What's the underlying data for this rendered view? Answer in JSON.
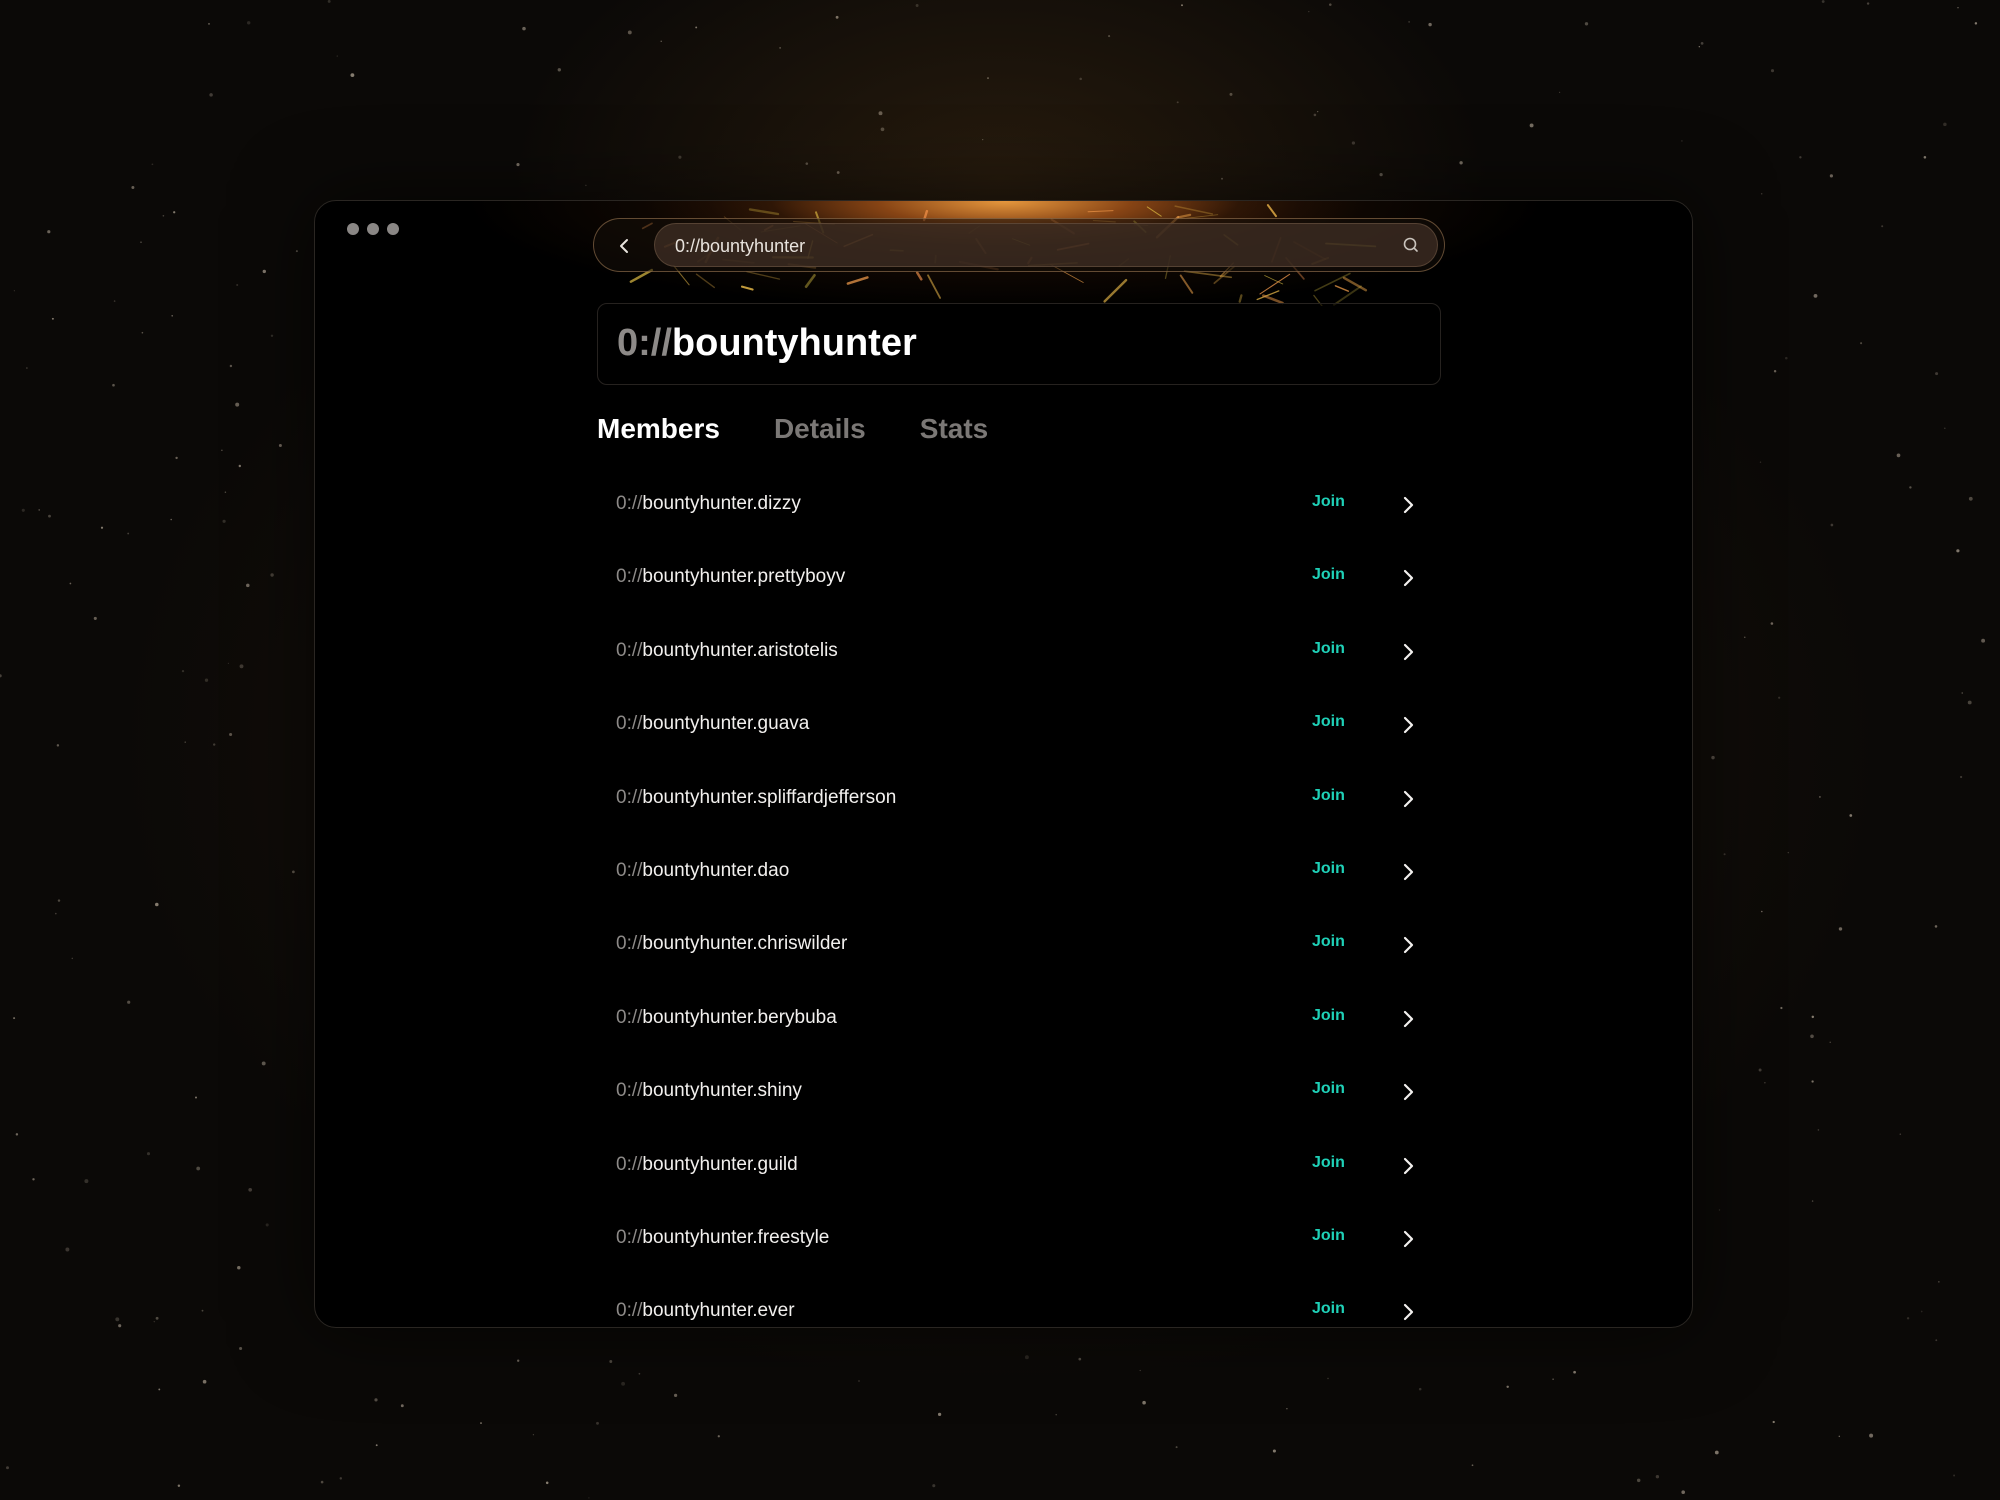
{
  "window": {
    "controls": [
      "window-dot",
      "window-dot",
      "window-dot"
    ]
  },
  "urlbar": {
    "back_icon": "chevron-left-icon",
    "value": "0://bountyhunter",
    "search_icon": "search-icon"
  },
  "header": {
    "title_prefix": "0://",
    "title_name": "bountyhunter"
  },
  "tabs": [
    {
      "label": "Members",
      "active": true
    },
    {
      "label": "Details",
      "active": false
    },
    {
      "label": "Stats",
      "active": false
    }
  ],
  "colors": {
    "accent": "#1fd1b8",
    "text": "#f2f0ee",
    "muted": "#8d8a88",
    "background": "#000000"
  },
  "members": {
    "prefix": "0://",
    "join_label": "Join",
    "row_icon": "chevron-right-icon",
    "items": [
      {
        "name": "bountyhunter.dizzy"
      },
      {
        "name": "bountyhunter.prettyboyv"
      },
      {
        "name": "bountyhunter.aristotelis"
      },
      {
        "name": "bountyhunter.guava"
      },
      {
        "name": "bountyhunter.spliffardjefferson"
      },
      {
        "name": "bountyhunter.dao"
      },
      {
        "name": "bountyhunter.chriswilder"
      },
      {
        "name": "bountyhunter.berybuba"
      },
      {
        "name": "bountyhunter.shiny"
      },
      {
        "name": "bountyhunter.guild"
      },
      {
        "name": "bountyhunter.freestyle"
      },
      {
        "name": "bountyhunter.ever"
      }
    ]
  }
}
